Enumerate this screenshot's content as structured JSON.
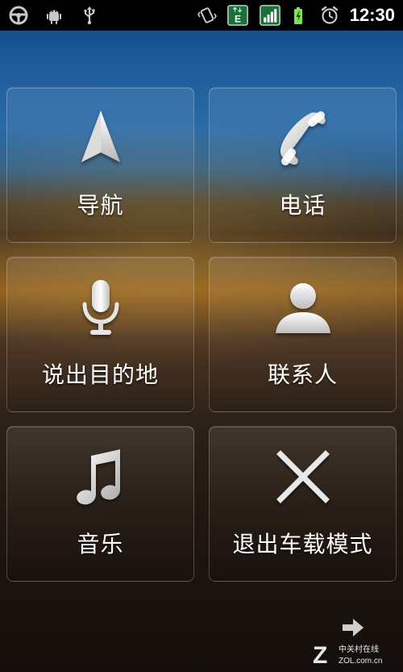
{
  "status_bar": {
    "time": "12:30",
    "network_type": "E",
    "icons": [
      "steering-wheel-icon",
      "android-icon",
      "usb-icon",
      "vibrate-icon",
      "network-type-icon",
      "signal-icon",
      "battery-charging-icon",
      "alarm-icon"
    ]
  },
  "tiles": [
    {
      "label": "导航",
      "icon": "navigation-arrow-icon"
    },
    {
      "label": "电话",
      "icon": "phone-handset-icon"
    },
    {
      "label": "说出目的地",
      "icon": "microphone-icon"
    },
    {
      "label": "联系人",
      "icon": "contact-person-icon"
    },
    {
      "label": "音乐",
      "icon": "music-note-icon"
    },
    {
      "label": "退出车载模式",
      "icon": "close-x-icon"
    }
  ],
  "next_page": {
    "icon": "right-arrow-icon"
  },
  "watermark": {
    "primary": "中关村在线",
    "secondary": "ZOL.com.cn"
  },
  "colors": {
    "status_bar_bg": "#000000",
    "network_badge": "#1f6f3c",
    "battery_green": "#7de64a",
    "tile_text": "#ffffff"
  }
}
